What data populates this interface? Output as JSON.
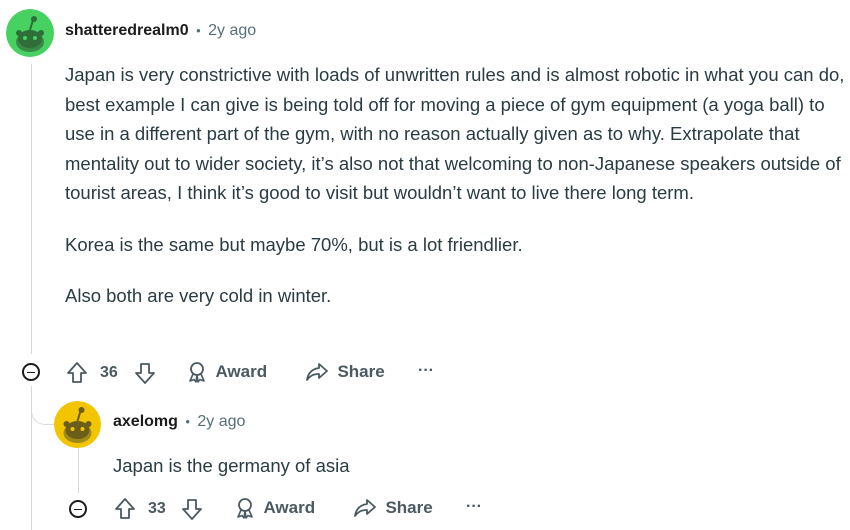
{
  "comments": [
    {
      "username": "shatteredrealm0",
      "separator": "•",
      "time": "2y ago",
      "paragraphs": [
        "Japan is very constrictive with loads of unwritten rules and is almost robotic in what you can do, best example I can give is being told off for moving a piece of gym equipment (a yoga ball) to use in a different part of the gym, with no reason actually given as to why. Extrapolate that mentality out to wider society, it’s also not that welcoming to non-Japanese speakers outside of tourist areas, I think it’s good to visit but wouldn’t want to live there long term.",
        "Korea is the same but maybe 70%, but is a lot friendlier.",
        "Also both are very cold in winter."
      ],
      "votes": "36",
      "award_label": "Award",
      "share_label": "Share",
      "more_label": "···",
      "avatar_color": "#46d160"
    },
    {
      "username": "axelomg",
      "separator": "•",
      "time": "2y ago",
      "paragraphs": [
        "Japan is the germany of asia"
      ],
      "votes": "33",
      "award_label": "Award",
      "share_label": "Share",
      "more_label": "···",
      "avatar_color": "#f2c500"
    }
  ]
}
